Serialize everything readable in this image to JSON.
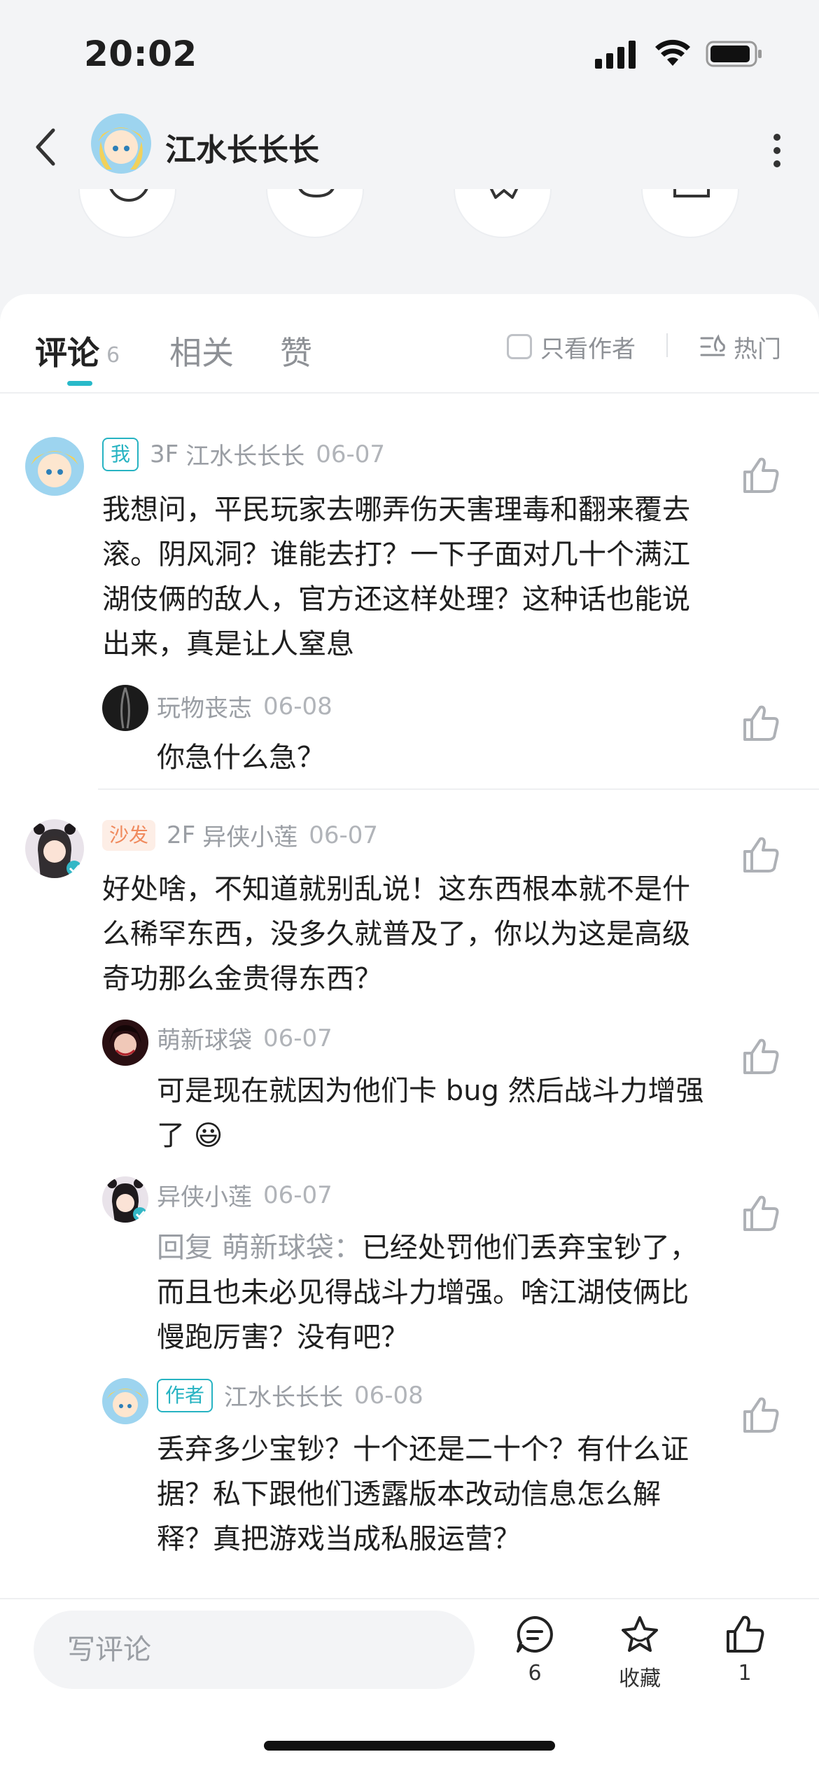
{
  "status_bar": {
    "time": "20:02"
  },
  "header": {
    "title": "江水长长长"
  },
  "tabs": {
    "comments_label": "评论",
    "comments_count": "6",
    "related_label": "相关",
    "likes_label": "赞",
    "author_only_label": "只看作者",
    "sort_label": "热门"
  },
  "comments": [
    {
      "badge": "我",
      "floor": "3F",
      "user": "江水长长长",
      "date": "06-07",
      "text": "我想问，平民玩家去哪弄伤天害理毒和翻来覆去滚。阴风洞？谁能去打？一下子面对几十个满江湖伎俩的敌人，官方还这样处理？这种话也能说出来，真是让人窒息",
      "replies": [
        {
          "user": "玩物丧志",
          "date": "06-08",
          "text": "你急什么急？"
        }
      ]
    },
    {
      "badge": "沙发",
      "floor": "2F",
      "user": "异侠小莲",
      "date": "06-07",
      "text": "好处啥，不知道就别乱说！这东西根本就不是什么稀罕东西，没多久就普及了，你以为这是高级奇功那么金贵得东西？",
      "replies": [
        {
          "user": "萌新球袋",
          "date": "06-07",
          "text": "可是现在就因为他们卡 bug 然后战斗力增强了 😃"
        },
        {
          "user": "异侠小莲",
          "date": "06-07",
          "reply_prefix": "回复 萌新球袋：",
          "text": "已经处罚他们丢弃宝钞了，而且也未必见得战斗力增强。啥江湖伎俩比慢跑厉害？没有吧？"
        },
        {
          "badge": "作者",
          "user": "江水长长长",
          "date": "06-08",
          "text": "丢弃多少宝钞？十个还是二十个？有什么证据？私下跟他们透露版本改动信息怎么解释？真把游戏当成私服运营？"
        }
      ]
    }
  ],
  "bottom_bar": {
    "input_placeholder": "写评论",
    "comment_count": "6",
    "favorite_label": "收藏",
    "like_count": "1"
  },
  "colors": {
    "accent": "#28b9c9",
    "sofa": "#f08a5d",
    "muted": "#9a9ea4"
  }
}
